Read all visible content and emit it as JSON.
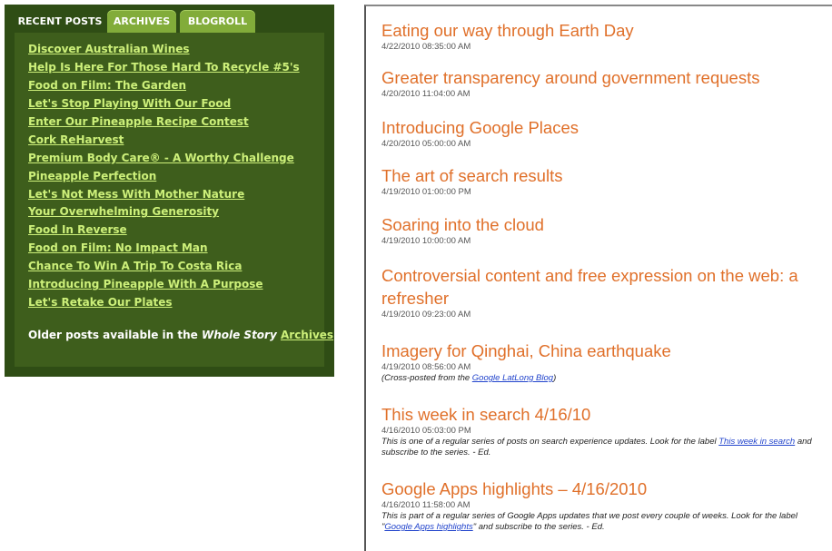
{
  "widget": {
    "tabs": [
      {
        "label": "RECENT POSTS"
      },
      {
        "label": "ARCHIVES"
      },
      {
        "label": "BLOGROLL"
      }
    ],
    "posts": [
      "Discover Australian Wines",
      "Help Is Here For Those Hard To Recycle #5's",
      "Food on Film: The Garden",
      "Let's Stop Playing With Our Food",
      "Enter Our Pineapple Recipe Contest",
      "Cork ReHarvest",
      "Premium Body Care® - A Worthy Challenge",
      "Pineapple Perfection",
      "Let's Not Mess With Mother Nature",
      "Your Overwhelming Generosity",
      "Food In Reverse",
      "Food on Film: No Impact Man",
      "Chance To Win A Trip To Costa Rica",
      "Introducing Pineapple With A Purpose",
      "Let's Retake Our Plates"
    ],
    "older": {
      "prefix": "Older posts available in the ",
      "brand": "Whole Story",
      "link": "Archives"
    }
  },
  "blog": {
    "entries": [
      {
        "title": "Eating our way through Earth Day",
        "date": "4/22/2010 08:35:00 AM"
      },
      {
        "title": "Greater transparency around government requests",
        "date": "4/20/2010 11:04:00 AM"
      },
      {
        "title": "Introducing Google Places",
        "date": "4/20/2010 05:00:00 AM"
      },
      {
        "title": "The art of search results",
        "date": "4/19/2010 01:00:00 PM"
      },
      {
        "title": "Soaring into the cloud",
        "date": "4/19/2010 10:00:00 AM"
      },
      {
        "title": "Controversial content and free expression on the web: a refresher",
        "date": "4/19/2010 09:23:00 AM"
      },
      {
        "title": "Imagery for Qinghai, China earthquake",
        "date": "4/19/2010 08:56:00 AM",
        "note": {
          "before": "(Cross-posted from the ",
          "link": "Google LatLong Blog",
          "after": ")"
        }
      },
      {
        "title": "This week in search 4/16/10",
        "date": "4/16/2010 05:03:00 PM",
        "note": {
          "before": "This is one of a regular series of posts on search experience updates. Look for the label ",
          "link": "This week in search",
          "after": " and subscribe to the series. - Ed."
        }
      },
      {
        "title": "Google Apps highlights – 4/16/2010",
        "date": "4/16/2010 11:58:00 AM",
        "note": {
          "before": "This is part of a regular series of Google Apps updates that we post every couple of weeks. Look for the label \"",
          "link": "Google Apps highlights",
          "after": "\" and subscribe to the series. - Ed."
        }
      }
    ]
  }
}
